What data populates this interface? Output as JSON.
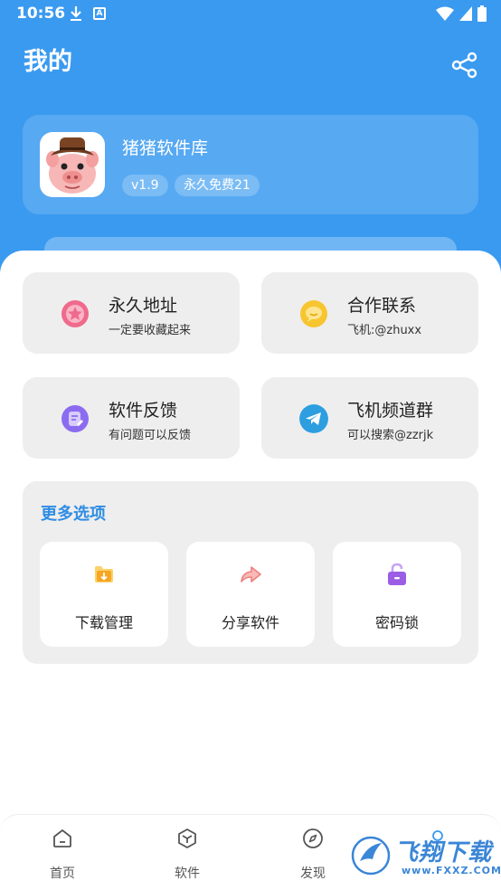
{
  "status_bar": {
    "time": "10:56"
  },
  "header": {
    "title": "我的"
  },
  "profile": {
    "app_name": "猪猪软件库",
    "version": "v1.9",
    "free_badge": "永久免费21"
  },
  "tiles": [
    {
      "title": "永久地址",
      "subtitle": "一定要收藏起来",
      "icon": "star-icon",
      "color": "#f06a8c"
    },
    {
      "title": "合作联系",
      "subtitle": "飞机:@zhuxx",
      "icon": "chat-bubble-icon",
      "color": "#f7c530"
    },
    {
      "title": "软件反馈",
      "subtitle": "有问题可以反馈",
      "icon": "feedback-icon",
      "color": "#8b6cf0"
    },
    {
      "title": "飞机频道群",
      "subtitle": "可以搜索@zzrjk",
      "icon": "telegram-icon",
      "color": "#2d9ee0"
    }
  ],
  "more_options": {
    "title": "更多选项",
    "items": [
      {
        "label": "下载管理",
        "icon": "download-folder-icon",
        "color": "#f5a623"
      },
      {
        "label": "分享软件",
        "icon": "share-arrow-icon",
        "color": "#ee7f7f"
      },
      {
        "label": "密码锁",
        "icon": "lock-icon",
        "color": "#9b5de5"
      }
    ]
  },
  "bottom_nav": [
    {
      "label": "首页",
      "icon": "home-icon"
    },
    {
      "label": "软件",
      "icon": "box-icon"
    },
    {
      "label": "发现",
      "icon": "compass-icon"
    },
    {
      "label": "",
      "icon": "profile-icon"
    }
  ],
  "watermark": {
    "text": "飞翔下载",
    "url": "www.FXXZ.COM"
  },
  "colors": {
    "primary": "#3a9af0",
    "accent_text": "#2f8de4",
    "tile_bg": "#eeeeee"
  }
}
